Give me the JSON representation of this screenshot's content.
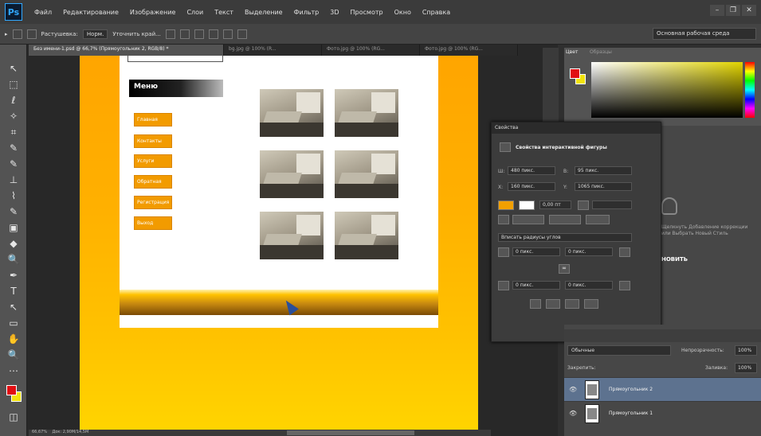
{
  "menubar": {
    "logo": "Ps",
    "items": [
      "Файл",
      "Редактирование",
      "Изображение",
      "Слои",
      "Текст",
      "Выделение",
      "Фильтр",
      "3D",
      "Просмотр",
      "Окно",
      "Справка"
    ],
    "window_controls": [
      "–",
      "❐",
      "✕"
    ]
  },
  "options": {
    "tool_label": "▸",
    "style_label": "Растушевка:",
    "style_value": "Норм.",
    "refine_label": "Уточнить край...",
    "workspace": "Основная рабочая среда"
  },
  "tabs": [
    {
      "label": "Без имени-1.psd @ 66,7% (Прямоугольник 2, RGB/8) *",
      "active": true
    },
    {
      "label": "bg.jpg @ 100% (R...",
      "active": false
    },
    {
      "label": "Фото.jpg @ 100% (RG...",
      "active": false
    },
    {
      "label": "Фото.jpg @ 100% (RG...",
      "active": false
    }
  ],
  "tools": [
    "↖",
    "⬚",
    "ℓ",
    "✧",
    "⌗",
    "✎",
    "✎",
    "⊥",
    "⌇",
    "✎",
    "▣",
    "◆",
    "🔍",
    "✒",
    "T",
    "↖",
    "▭",
    "✋",
    "🔍",
    "⋯",
    "◫"
  ],
  "document": {
    "menu_title": "Меню",
    "menu_buttons": [
      "Главная",
      "Контакты",
      "Услуги",
      "Обратная",
      "Регистрация",
      "Выход"
    ],
    "thumbnail_count": 6
  },
  "color_panel": {
    "tab_active": "Цвет",
    "tab_inactive": "Образцы",
    "foreground": "#e10e12",
    "background": "#f2e30c"
  },
  "properties": {
    "header": "Свойства",
    "title": "Свойства интерактивной фигуры",
    "w_label": "Ш:",
    "w_value": "480 пикс.",
    "h_label": "В:",
    "h_value": "95 пикс.",
    "x_label": "X:",
    "x_value": "160 пикс.",
    "y_label": "Y:",
    "y_value": "1065 пикс.",
    "stroke_width": "0,00 пт",
    "corners_label": "Вписать радиусы углов",
    "radius_values": [
      "0 пикс.",
      "0 пикс.",
      "0 пикс.",
      "0 пикс."
    ],
    "link_label": "∞"
  },
  "adjustments": {
    "caption": "Щелкнуть Добавление коррекции или Выбрать Новый Стиль",
    "new_label": "НОВИТЬ"
  },
  "layers": {
    "blend_mode": "Обычные",
    "opacity_label": "Непрозрачность:",
    "opacity_value": "100%",
    "lock_label": "Закрепить:",
    "fill_label": "Заливка:",
    "fill_value": "100%",
    "items": [
      {
        "name": "Прямоугольник 2",
        "selected": true
      },
      {
        "name": "Прямоугольник 1",
        "selected": false
      }
    ]
  },
  "status": {
    "zoom": "66,67%",
    "doc_info": "Док: 2,90М/14,5М"
  }
}
